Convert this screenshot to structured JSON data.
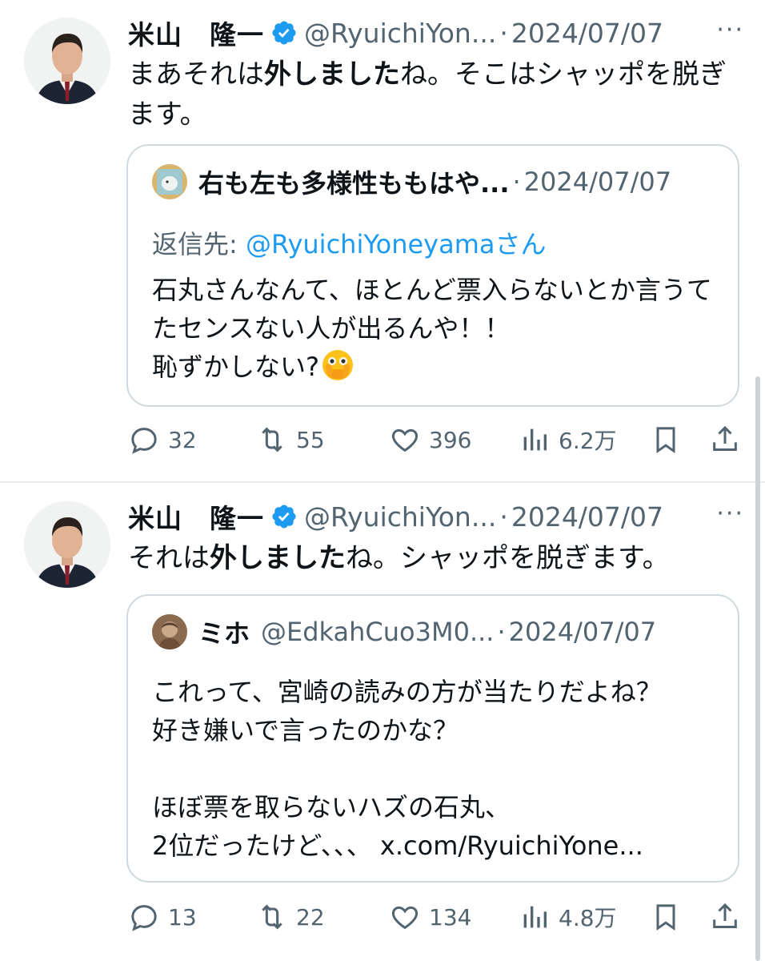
{
  "tweets": [
    {
      "author": "米山　隆一",
      "handle": "@RyuichiYon...",
      "dot": "·",
      "date": "2024/07/07",
      "more": "···",
      "text_parts": [
        "まあそれは",
        "外しました",
        "ね。そこはシャッポを脱ぎます。"
      ],
      "quote": {
        "author": "右も左も多様性ももはや...",
        "handle": "",
        "dot": "·",
        "date": "2024/07/07",
        "reply_prefix": "返信先: ",
        "reply_mention": "@RyuichiYoneyama",
        "reply_suffix": "さん",
        "text": "石丸さんなんて、ほとんど票入らないとか言うてたセンスない人が出るんや！！\n恥ずかしない?",
        "emoji": "face-with-open-eyes-and-hand-over-mouth"
      },
      "stats": {
        "replies": "32",
        "retweets": "55",
        "likes": "396",
        "views": "6.2万"
      }
    },
    {
      "author": "米山　隆一",
      "handle": "@RyuichiYon...",
      "dot": "·",
      "date": "2024/07/07",
      "more": "···",
      "text_parts": [
        "それは",
        "外しました",
        "ね。シャッポを脱ぎます。"
      ],
      "quote": {
        "author": "ミホ",
        "handle": "@EdkahCuo3M0...",
        "dot": "·",
        "date": "2024/07/07",
        "text": "これって、宮崎の読みの方が当たりだよね？\n好き嫌いで言ったのかな？\n\nほぼ票を取らないハズの石丸、\n2位だったけど、、、 x.com/RyuichiYone..."
      },
      "stats": {
        "replies": "13",
        "retweets": "22",
        "likes": "134",
        "views": "4.8万"
      }
    }
  ],
  "colors": {
    "accent": "#1d9bf0",
    "muted": "#536471",
    "border": "#cfd9de"
  },
  "icons": [
    "verified-badge-icon",
    "more-icon",
    "reply-icon",
    "retweet-icon",
    "like-icon",
    "views-icon",
    "bookmark-icon",
    "share-icon"
  ]
}
